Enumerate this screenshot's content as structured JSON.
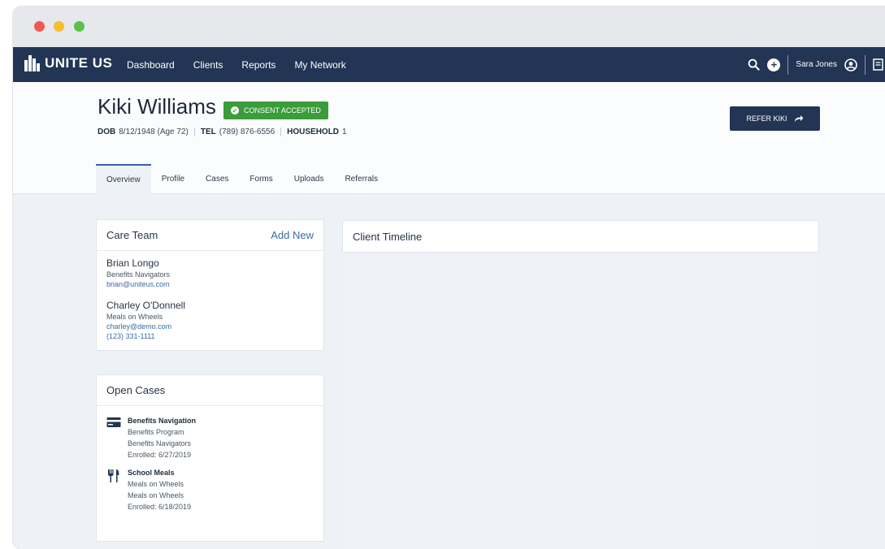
{
  "navbar": {
    "logo_text": "UNITE US",
    "links": [
      "Dashboard",
      "Clients",
      "Reports",
      "My Network"
    ],
    "user_name": "Sara Jones"
  },
  "client": {
    "name": "Kiki Williams",
    "consent_badge": "CONSENT ACCEPTED",
    "dob_label": "DOB",
    "dob_value": "8/12/1948 (Age 72)",
    "tel_label": "TEL",
    "tel_value": "(789) 876-6556",
    "household_label": "HOUSEHOLD",
    "household_value": "1",
    "refer_button": "REFER KIKI"
  },
  "tabs": [
    "Overview",
    "Profile",
    "Cases",
    "Forms",
    "Uploads",
    "Referrals"
  ],
  "care_team": {
    "title": "Care Team",
    "add_new": "Add New",
    "members": [
      {
        "name": "Brian Longo",
        "org": "Benefits Navigators",
        "email": "brian@uniteus.com"
      },
      {
        "name": "Charley O'Donnell",
        "org": "Meals on Wheels",
        "email": "charley@demo.com",
        "phone": "(123) 331-1111"
      }
    ]
  },
  "open_cases": {
    "title": "Open Cases",
    "cases": [
      {
        "icon": "credit-card-icon",
        "title": "Benefits Navigation",
        "program": "Benefits Program",
        "org": "Benefits Navigators",
        "enrolled": "Enrolled: 6/27/2019"
      },
      {
        "icon": "fork-knife-icon",
        "title": "School Meals",
        "program": "Meals on Wheels",
        "org": "Meals on Wheels",
        "enrolled": "Enrolled: 6/18/2019"
      }
    ]
  },
  "timeline": {
    "title": "Client Timeline"
  },
  "colors": {
    "navbar": "#223554",
    "consent": "#3a9c3a",
    "link": "#3a6aa8"
  }
}
